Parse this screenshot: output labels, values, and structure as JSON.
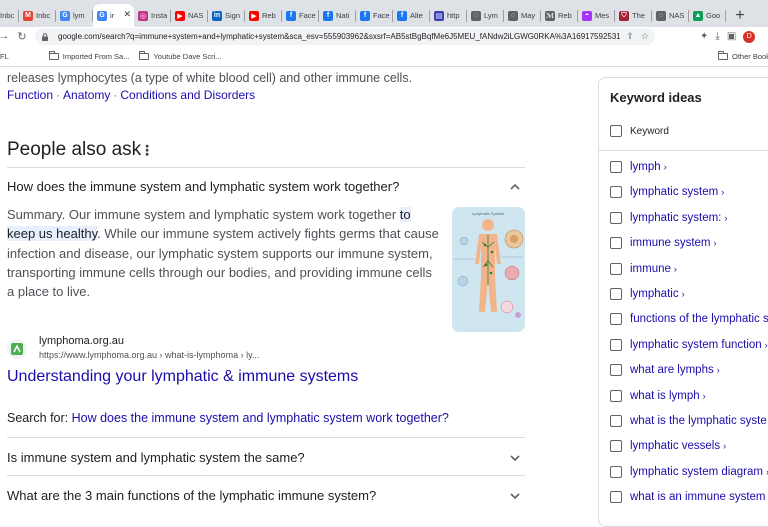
{
  "tabs": [
    {
      "label": "Inbc",
      "icon": "gmail-icon",
      "fav": "M",
      "color": "#ea4335"
    },
    {
      "label": "Inbc",
      "icon": "gmail-icon",
      "fav": "M",
      "color": "#ea4335"
    },
    {
      "label": "lym",
      "icon": "google-icon",
      "fav": "G",
      "color": "#4285f4"
    },
    {
      "label": "ir",
      "icon": "google-icon",
      "fav": "G",
      "color": "#4285f4"
    },
    {
      "label": "Insta",
      "icon": "instagram-icon",
      "fav": "◎",
      "color": "#c13584"
    },
    {
      "label": "NAS",
      "icon": "youtube-icon",
      "fav": "▶",
      "color": "#ff0000"
    },
    {
      "label": "Sign",
      "icon": "linkedin-icon",
      "fav": "in",
      "color": "#0a66c2"
    },
    {
      "label": "Reb",
      "icon": "youtube-icon",
      "fav": "▶",
      "color": "#ff0000"
    },
    {
      "label": "Face",
      "icon": "facebook-icon",
      "fav": "f",
      "color": "#1877f2"
    },
    {
      "label": "Nati",
      "icon": "facebook-icon",
      "fav": "f",
      "color": "#1877f2"
    },
    {
      "label": "Face",
      "icon": "facebook-icon",
      "fav": "f",
      "color": "#1877f2"
    },
    {
      "label": "Alte",
      "icon": "facebook-icon",
      "fav": "f",
      "color": "#1877f2"
    },
    {
      "label": "http",
      "icon": "page-icon",
      "fav": "▤",
      "color": "#3b3fb6"
    },
    {
      "label": "Lym",
      "icon": "globe-icon",
      "fav": "◌",
      "color": "#5f6368"
    },
    {
      "label": "May",
      "icon": "globe-icon",
      "fav": "◌",
      "color": "#5f6368"
    },
    {
      "label": "Reb",
      "icon": "site-icon",
      "fav": "ℳ",
      "color": "#5f6368"
    },
    {
      "label": "Mes",
      "icon": "messenger-icon",
      "fav": "◓",
      "color": "#a334fa"
    },
    {
      "label": "The",
      "icon": "shield-icon",
      "fav": "⛉",
      "color": "#a31f34"
    },
    {
      "label": "NAS",
      "icon": "globe-icon",
      "fav": "◌",
      "color": "#5f6368"
    },
    {
      "label": "Goo",
      "icon": "drive-icon",
      "fav": "▲",
      "color": "#0f9d58"
    }
  ],
  "toolbar": {
    "url": "google.com/search?q=immune+system+and+lymphatic+system&sca_esv=555903962&sxsrf=AB5stBgBqfMe6J5MEU_fANdw2iLGWG0RKA%3A1691759253127…",
    "profile_initial": "D"
  },
  "bookmarks": {
    "partial": "FL",
    "items": [
      "Imported From Sa...",
      "Youtube Dave Scri..."
    ],
    "other": "Other Book"
  },
  "result": {
    "snippet_text": "releases lymphocytes (a type of white blood cell) and other immune cells.",
    "links": [
      "Function",
      "Anatomy",
      "Conditions and Disorders"
    ]
  },
  "paa": {
    "title": "People also ask",
    "q1": "How does the immune system and lymphatic system work together?",
    "answer_before": "Summary. Our immune system and lymphatic system work together ",
    "answer_highlight": "to keep us healthy",
    "answer_after": ". While our immune system actively fights germs that cause infection and disease, our lymphatic system supports our immune system, transporting immune cells through our bodies, and providing immune cells a place to live.",
    "thumb_title": "Lymphatic System",
    "source_name": "lymphoma.org.au",
    "source_url": "https://www.lymphoma.org.au › what-is-lymphoma › ly...",
    "source_title": "Understanding your lymphatic & immune systems",
    "search_for_label": "Search for:",
    "search_for_link": "How does the immune system and lymphatic system work together?",
    "q2": "Is immune system and lymphatic system the same?",
    "q3": "What are the 3 main functions of the lymphatic immune system?"
  },
  "keywords": {
    "title": "Keyword ideas",
    "header": "Keyword",
    "items": [
      "lymph",
      "lymphatic system",
      "lymphatic system:",
      "immune system",
      "immune",
      "lymphatic",
      "functions of the lymphatic s",
      "lymphatic system function",
      "what are lymphs",
      "what is lymph",
      "what is the lymphatic syste",
      "lymphatic vessels",
      "lymphatic system diagram",
      "what is an immune system"
    ]
  }
}
